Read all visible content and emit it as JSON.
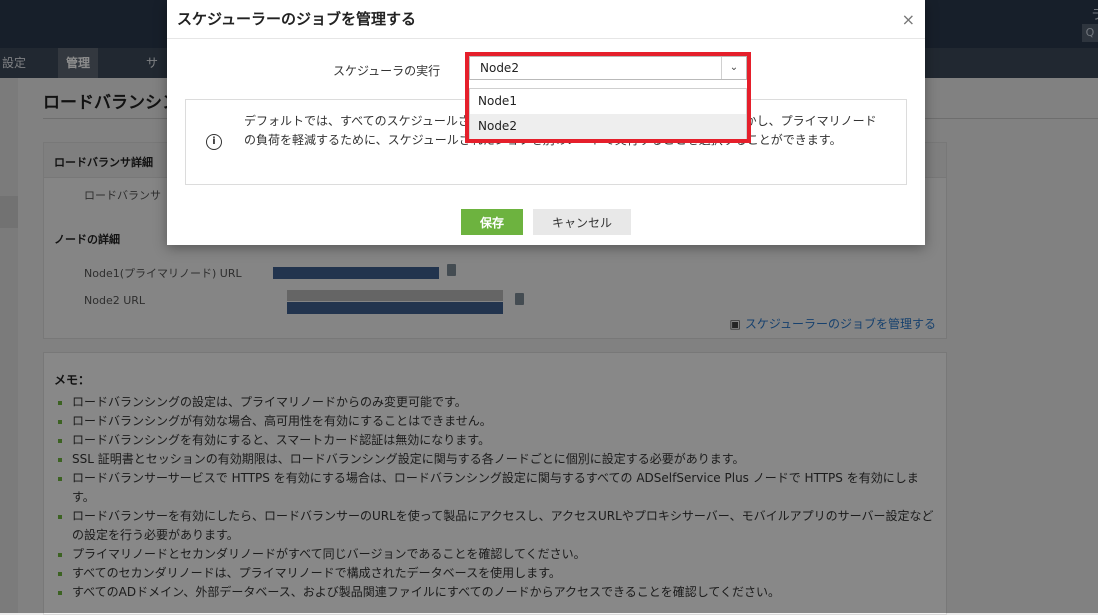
{
  "topbar": {
    "right_label": "ラ",
    "search_glyph": "Q"
  },
  "nav": {
    "tabs": [
      "設定",
      "管理",
      "サ"
    ],
    "active_index": 1
  },
  "page": {
    "title": "ロードバランシン"
  },
  "panel": {
    "lb_details_label": "ロードバランサ詳細",
    "lb_row_label": "ロードバランサ",
    "node_details_label": "ノードの詳細",
    "node1_label": "Node1(プライマリノード) URL",
    "node2_label": "Node2 URL",
    "manage_link": "スケジューラーのジョブを管理する"
  },
  "memo": {
    "title": "メモ：",
    "items": [
      "ロードバランシングの設定は、プライマリノードからのみ変更可能です。",
      "ロードバランシングが有効な場合、高可用性を有効にすることはできません。",
      "ロードバランシングを有効にすると、スマートカード認証は無効になります。",
      "SSL 証明書とセッションの有効期限は、ロードバランシング設定に関与する各ノードごとに個別に設定する必要があります。",
      "ロードバランサーサービスで HTTPS を有効にする場合は、ロードバランシング設定に関与するすべての ADSelfService Plus ノードで HTTPS を有効にします。",
      "ロードバランサーを有効にしたら、ロードバランサーのURLを使って製品にアクセスし、アクセスURLやプロキシサーバー、モバイルアプリのサーバー設定などの設定を行う必要があります。",
      "プライマリノードとセカンダリノードがすべて同じバージョンであることを確認してください。",
      "すべてのセカンダリノードは、プライマリノードで構成されたデータベースを使用します。",
      "すべてのADドメイン、外部データベース、および製品関連ファイルにすべてのノードからアクセスできることを確認してください。"
    ]
  },
  "modal": {
    "title": "スケジューラーのジョブを管理する",
    "close_glyph": "×",
    "field_label": "スケジューラの実行",
    "select_value": "Node2",
    "select_arrow": "⌄",
    "options": [
      "Node1",
      "Node2"
    ],
    "selected_option": "Node2",
    "info_glyph": "i",
    "info_text": "デフォルトでは、すべてのスケジュールされたジョブはプライマリノードで実行されます。しかし、プライマリノードの負荷を軽減するために、スケジュールされたジョブを別のノードで実行することを選択することができます。",
    "save_label": "保存",
    "cancel_label": "キャンセル"
  },
  "colors": {
    "accent_green": "#6db33f",
    "link_blue": "#2a77c8",
    "highlight_red": "#e51f2b",
    "topbar": "#2a3a4d"
  }
}
